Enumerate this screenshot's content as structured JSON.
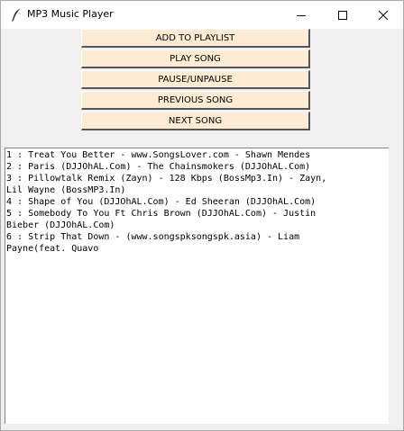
{
  "window": {
    "title": "MP3 Music Player",
    "icon": "feather-icon",
    "controls": [
      "minimize-icon",
      "maximize-icon",
      "close-icon"
    ]
  },
  "buttons": {
    "add_to_playlist": "ADD TO PLAYLIST",
    "play_song": "PLAY SONG",
    "pause_unpause": "PAUSE/UNPAUSE",
    "previous_song": "PREVIOUS SONG",
    "next_song": "NEXT SONG"
  },
  "colors": {
    "button_bg": "#fdebd4",
    "window_bg": "#f0f0f0",
    "list_bg": "#ffffff"
  },
  "playlist": {
    "lines": [
      "1 : Treat You Better - www.SongsLover.com - Shawn Mendes",
      "2 : Paris (DJJOhAL.Com) - The Chainsmokers (DJJOhAL.Com)",
      "3 : Pillowtalk Remix (Zayn) - 128 Kbps (BossMp3.In) - Zayn,",
      "Lil Wayne (BossMP3.In)",
      "4 : Shape of You (DJJOhAL.Com) - Ed Sheeran (DJJOhAL.Com)",
      "5 : Somebody To You Ft Chris Brown (DJJOhAL.Com) - Justin",
      "Bieber (DJJOhAL.Com)",
      "6 : Strip That Down - (www.songspksongspk.asia) - Liam",
      "Payne(feat. Quavo"
    ]
  }
}
